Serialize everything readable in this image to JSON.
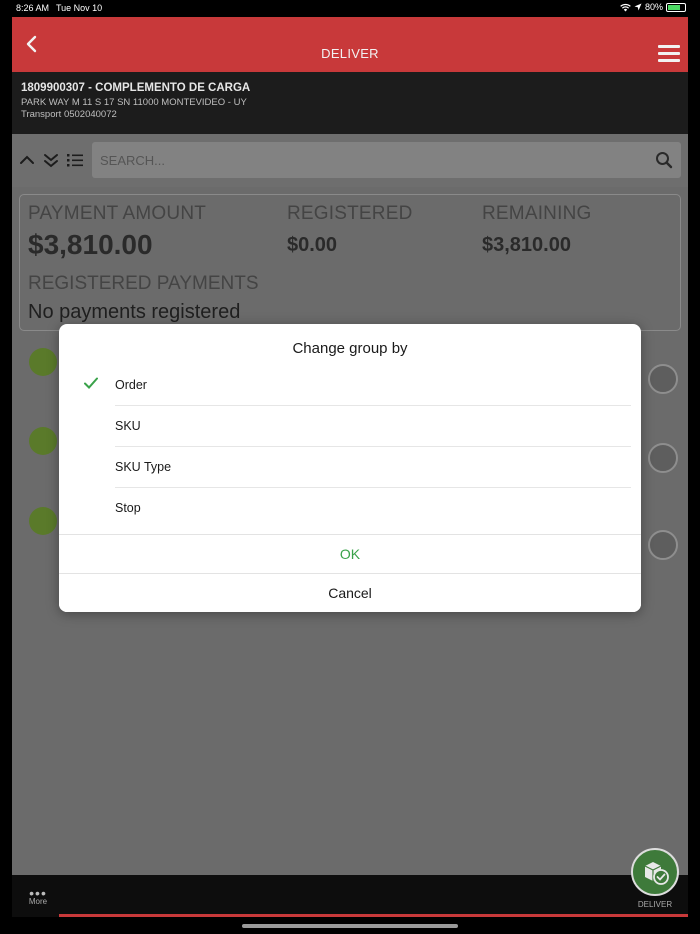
{
  "status": {
    "time": "8:26 AM",
    "date": "Tue Nov 10",
    "battery": "80%"
  },
  "header": {
    "title": "DELIVER",
    "back_icon": "chevron-left-icon",
    "menu_icon": "hamburger-icon"
  },
  "info": {
    "order": "1809900307 - COMPLEMENTO DE CARGA",
    "address": "PARK WAY M 11 S 17 SN 11000 MONTEVIDEO - UY",
    "transport": "Transport 0502040072"
  },
  "search": {
    "placeholder": "SEARCH..."
  },
  "payment": {
    "amount_label": "PAYMENT AMOUNT",
    "amount_value": "$3,810.00",
    "registered_label": "REGISTERED",
    "registered_value": "$0.00",
    "remaining_label": "REMAINING",
    "remaining_value": "$3,810.00",
    "registered_payments_label": "REGISTERED PAYMENTS",
    "registered_payments_value": "No payments registered"
  },
  "dialog": {
    "title": "Change group by",
    "options": [
      {
        "label": "Order",
        "selected": true
      },
      {
        "label": "SKU",
        "selected": false
      },
      {
        "label": "SKU Type",
        "selected": false
      },
      {
        "label": "Stop",
        "selected": false
      }
    ],
    "ok_label": "OK",
    "cancel_label": "Cancel"
  },
  "bottom": {
    "more_label": "More",
    "deliver_label": "DELIVER"
  },
  "colors": {
    "brand_red": "#c8393a",
    "ok_green": "#3aa24a",
    "deliver_green": "#3e7a3a"
  }
}
